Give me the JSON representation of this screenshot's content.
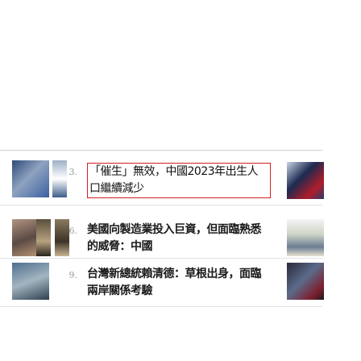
{
  "list": {
    "items": [
      {
        "rank": "3.",
        "headline": "「催生」無效，中國2023年出生人口繼續減少",
        "thumb_icon": "news-photo-icon",
        "side_icon": "news-photo-icon"
      },
      {
        "rank": "6.",
        "headline": "美國向製造業投入巨資，但面臨熟悉的威脅：中國",
        "thumb_icon": "news-photo-icon",
        "side_icon": "news-photo-icon"
      },
      {
        "rank": "9.",
        "headline": "台灣新總統賴清德：草根出身，面臨兩岸關係考驗",
        "thumb_icon": "news-photo-icon",
        "side_icon": "news-photo-icon"
      }
    ]
  },
  "colors": {
    "highlight_border": "#d61f1f",
    "divider": "#e3e3e3",
    "rank_text": "#9a9a9a"
  }
}
